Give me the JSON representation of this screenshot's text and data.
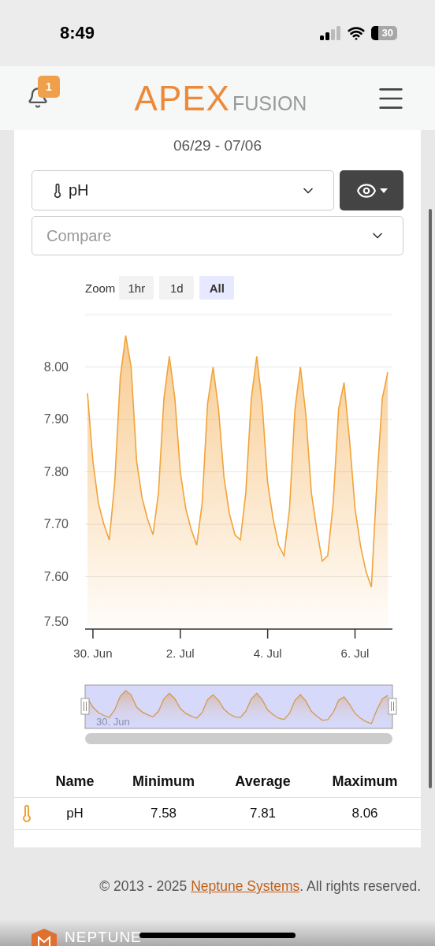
{
  "status_bar": {
    "time": "8:49",
    "battery": "30"
  },
  "header": {
    "notifications": "1",
    "logo": {
      "primary": "APEX",
      "secondary": "FUSION"
    }
  },
  "date_range": "06/29 - 07/06",
  "probe_select": {
    "value": "pH"
  },
  "compare_select": {
    "placeholder": "Compare"
  },
  "zoom": {
    "label": "Zoom",
    "options": [
      {
        "label": "1hr",
        "selected": false
      },
      {
        "label": "1d",
        "selected": false
      },
      {
        "label": "All",
        "selected": true
      }
    ]
  },
  "chart": {
    "chart_data": {
      "type": "area",
      "grid": true,
      "ylim": [
        7.5,
        8.1
      ],
      "yticks": [
        {
          "value": 7.5,
          "label": "7.50"
        },
        {
          "value": 7.6,
          "label": "7.60"
        },
        {
          "value": 7.7,
          "label": "7.70"
        },
        {
          "value": 7.8,
          "label": "7.80"
        },
        {
          "value": 7.9,
          "label": "7.90"
        },
        {
          "value": 8.0,
          "label": "8.00"
        }
      ],
      "categories": [
        null,
        "30. Jun",
        null,
        null,
        null,
        null,
        null,
        null,
        null,
        null,
        null,
        null,
        null,
        null,
        null,
        null,
        null,
        "2. Jul",
        null,
        null,
        null,
        null,
        null,
        null,
        null,
        null,
        null,
        null,
        null,
        null,
        null,
        null,
        null,
        "4. Jul",
        null,
        null,
        null,
        null,
        null,
        null,
        null,
        null,
        null,
        null,
        null,
        null,
        null,
        null,
        null,
        "6. Jul",
        null,
        null,
        null,
        null,
        null,
        null
      ],
      "series": [
        {
          "color": "#f2a33a",
          "values": [
            7.95,
            7.82,
            7.74,
            7.7,
            7.67,
            7.78,
            7.98,
            8.06,
            8.0,
            7.82,
            7.75,
            7.71,
            7.68,
            7.76,
            7.94,
            8.02,
            7.94,
            7.8,
            7.73,
            7.69,
            7.66,
            7.74,
            7.93,
            8.0,
            7.92,
            7.79,
            7.72,
            7.68,
            7.67,
            7.76,
            7.94,
            8.02,
            7.93,
            7.78,
            7.71,
            7.66,
            7.64,
            7.73,
            7.92,
            8.0,
            7.91,
            7.76,
            7.69,
            7.63,
            7.64,
            7.74,
            7.92,
            7.97,
            7.86,
            7.73,
            7.66,
            7.61,
            7.58,
            7.78,
            7.94,
            7.99
          ]
        }
      ]
    },
    "navigator": {
      "label": "30. Jun"
    }
  },
  "stats_table": {
    "columns": [
      "Name",
      "Minimum",
      "Average",
      "Maximum"
    ],
    "rows": [
      {
        "cells": [
          "pH",
          "7.58",
          "7.81",
          "8.06"
        ]
      }
    ]
  },
  "footer": {
    "before": "© 2013 - 2025 ",
    "link": "Neptune Systems",
    "after": ". All rights reserved."
  },
  "brand": "NEPTUNE"
}
